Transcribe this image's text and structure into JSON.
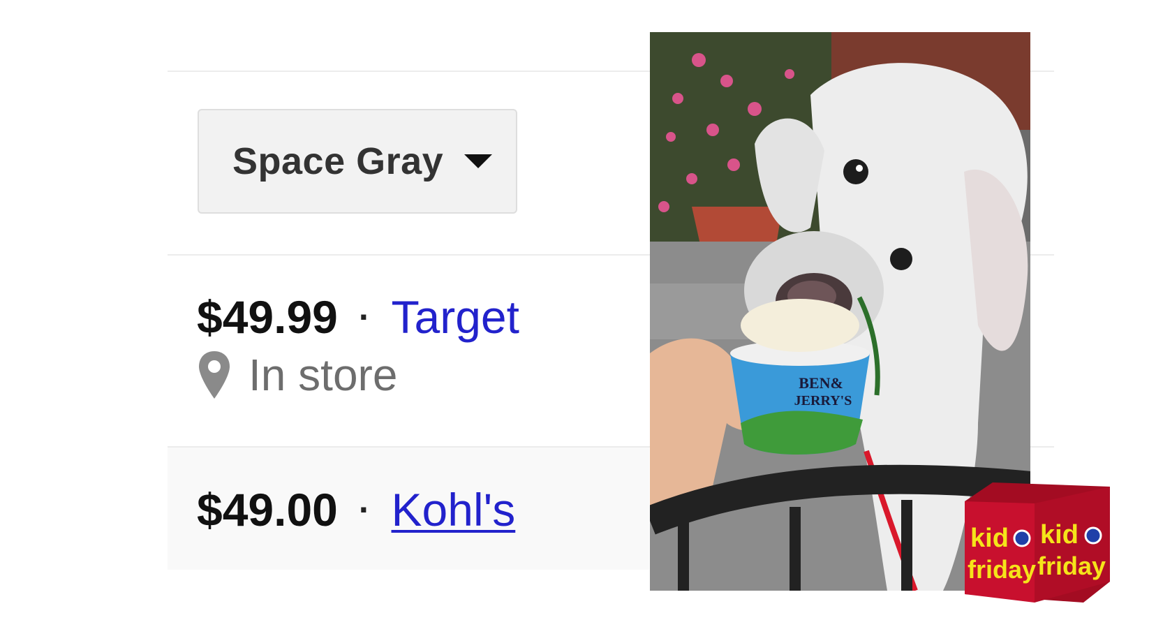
{
  "selector": {
    "label": "Space Gray"
  },
  "offers": [
    {
      "price": "$49.99",
      "separator": "·",
      "store": "Target",
      "availability": "In store"
    },
    {
      "price": "$49.00",
      "separator": "·",
      "store": "Kohl's"
    }
  ],
  "photo": {
    "cup_text_line1": "BEN&",
    "cup_text_line2": "JERRY'S"
  },
  "logo": {
    "word1": "kid",
    "word2": "friday"
  },
  "colors": {
    "link": "#2222cc",
    "price": "#111111",
    "muted": "#6d6d6d",
    "logo_red": "#c8102e",
    "logo_yellow": "#f5e41a"
  }
}
